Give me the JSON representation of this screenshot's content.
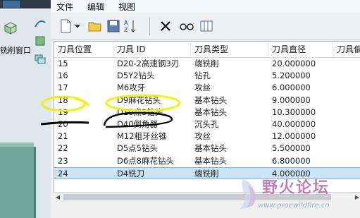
{
  "left_pane": {
    "label": "铣削窗口"
  },
  "menu": {
    "items": [
      "文件",
      "编辑",
      "视图"
    ]
  },
  "toolbar": {
    "buttons": [
      "new-icon",
      "dropdown-icon",
      "open-folder-icon",
      "save-icon",
      "sort-icon",
      "delete-icon",
      "glasses-icon",
      "columns-icon"
    ]
  },
  "table": {
    "columns": [
      "刀具位置",
      "刀具 ID",
      "刀具类型",
      "刀具直径",
      "刀具偏转"
    ],
    "rows": [
      {
        "pos": "15",
        "id": "D20-2高速钢3刃",
        "type": "端铣削",
        "dia": "20.000000"
      },
      {
        "pos": "16",
        "id": "D5Y2钻头",
        "type": "钻孔",
        "dia": "5.200000"
      },
      {
        "pos": "17",
        "id": "M6攻牙",
        "type": "攻丝",
        "dia": "6.000000"
      },
      {
        "pos": "18",
        "id": "D9麻花钻头",
        "type": "基本钻头",
        "dia": "9.000000"
      },
      {
        "pos": "19",
        "id": "D10点3钻头",
        "type": "基本钻头",
        "dia": "10.300000"
      },
      {
        "pos": "20",
        "id": "D40倒角器",
        "type": "沉头孔",
        "dia": "40.000000"
      },
      {
        "pos": "21",
        "id": "M12粗牙丝锥",
        "type": "攻丝",
        "dia": "12.000000"
      },
      {
        "pos": "22",
        "id": "D5点5钻头",
        "type": "基本钻头",
        "dia": "5.500000"
      },
      {
        "pos": "23",
        "id": "D6点8麻花钻头",
        "type": "基本钻头",
        "dia": "6.800000"
      },
      {
        "pos": "24",
        "id": "D4铣刀",
        "type": "端铣削",
        "dia": "4.000000"
      }
    ],
    "selected_row": "24"
  },
  "watermark": {
    "text": "野火论坛",
    "url": "www.proewildfire.cn"
  },
  "colors": {
    "selection": "#cce4f8",
    "highlight_yellow": "#f2f20a",
    "annotation_black": "#000000"
  }
}
